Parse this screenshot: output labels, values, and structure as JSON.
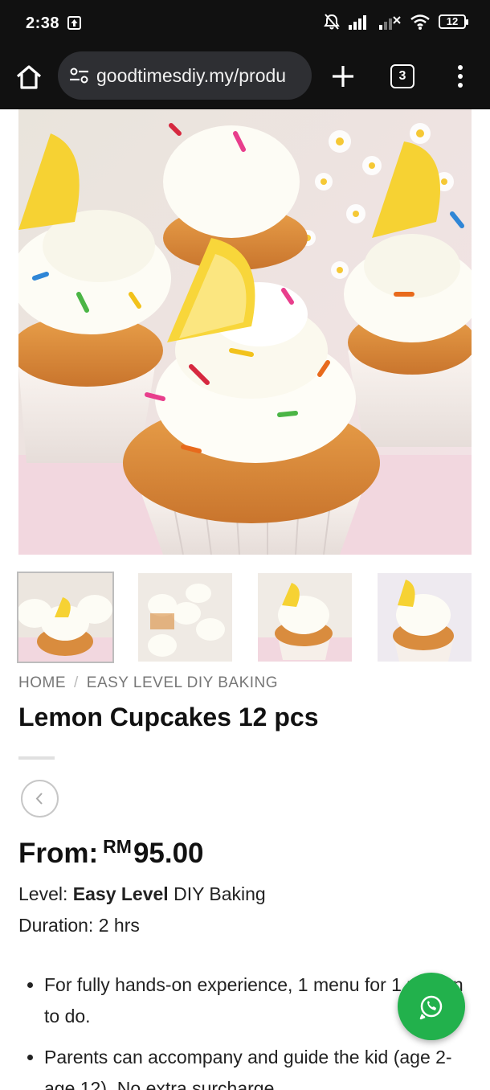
{
  "status_bar": {
    "time": "2:38",
    "battery": "12",
    "icons": [
      "upload-icon",
      "mute-icon",
      "signal-icon",
      "signal-weak-icon",
      "wifi-icon",
      "battery-icon"
    ]
  },
  "browser": {
    "url": "goodtimesdiy.my/produ",
    "tab_count": "3",
    "icons": [
      "home-icon",
      "tune-icon",
      "plus-icon",
      "tabs-icon",
      "more-vert-icon"
    ]
  },
  "gallery": {
    "thumbnail_count": 4,
    "active_index": 0
  },
  "breadcrumb": {
    "home": "HOME",
    "separator": "/",
    "category": "EASY LEVEL DIY BAKING"
  },
  "product": {
    "title": "Lemon Cupcakes 12 pcs",
    "price_prefix": "From:",
    "currency": "RM",
    "price": "95.00",
    "level_label": "Level:",
    "level_value": "Easy Level",
    "level_suffix": "DIY Baking",
    "duration": "Duration: 2 hrs",
    "bullets": [
      "For fully hands-on experience, 1 menu for 1 person to do.",
      "Parents can accompany and guide the kid (age 2- age 12). No extra surcharge."
    ]
  },
  "colors": {
    "whatsapp": "#22b14c",
    "browser_bg": "#111111"
  }
}
